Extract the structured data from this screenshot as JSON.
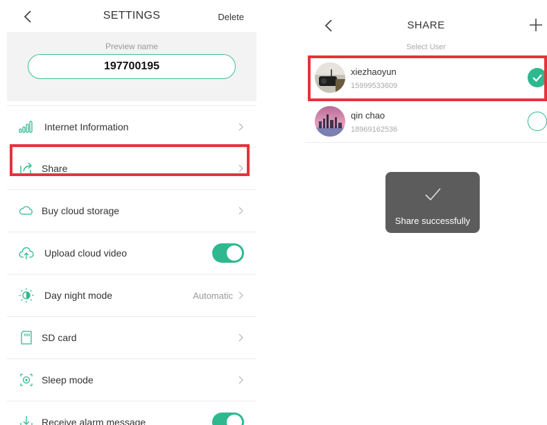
{
  "settings": {
    "title": "SETTINGS",
    "delete_label": "Delete",
    "preview_label": "Preview name",
    "preview_value": "197700195",
    "items": [
      {
        "label": "Internet Information",
        "icon": "signal-bars-icon",
        "control": "chevron"
      },
      {
        "label": "Share",
        "icon": "share-icon",
        "control": "chevron"
      },
      {
        "label": "Buy cloud storage",
        "icon": "cloud-icon",
        "control": "chevron"
      },
      {
        "label": "Upload cloud video",
        "icon": "cloud-upload-icon",
        "control": "toggle",
        "on": true
      },
      {
        "label": "Day night mode",
        "icon": "day-night-icon",
        "control": "chevron",
        "value": "Automatic"
      },
      {
        "label": "SD card",
        "icon": "sd-card-icon",
        "control": "chevron"
      },
      {
        "label": "Sleep mode",
        "icon": "sleep-icon",
        "control": "chevron"
      },
      {
        "label": "Receive alarm message",
        "icon": "alarm-download-icon",
        "control": "toggle",
        "on": true
      }
    ]
  },
  "share": {
    "title": "SHARE",
    "subtitle": "Select User",
    "users": [
      {
        "name": "xiezhaoyun",
        "phone": "15999533609",
        "selected": true
      },
      {
        "name": "qin chao",
        "phone": "18969162536",
        "selected": false
      }
    ],
    "toast": "Share successfully"
  },
  "colors": {
    "accent": "#2fb890",
    "highlight": "#e3333b",
    "toast_bg": "#5c5c5c"
  }
}
